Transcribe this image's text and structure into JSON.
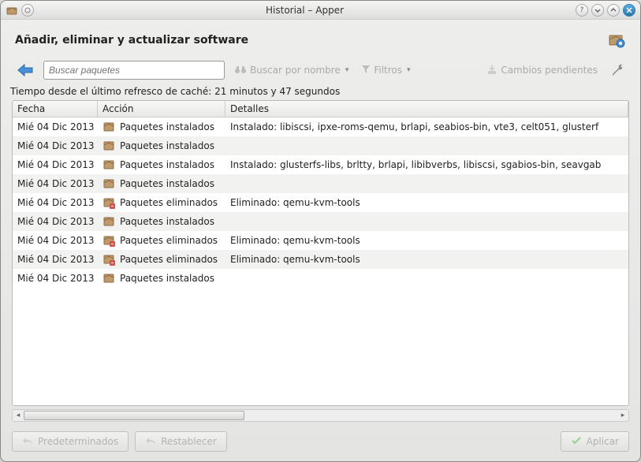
{
  "window": {
    "title": "Historial – Apper"
  },
  "header": {
    "title": "Añadir, eliminar y actualizar software"
  },
  "toolbar": {
    "search_placeholder": "Buscar paquetes",
    "search_by_name": "Buscar por nombre",
    "filters": "Filtros",
    "pending_changes": "Cambios pendientes"
  },
  "cache_status": "Tiempo desde el último refresco de caché: 21 minutos y 47 segundos",
  "columns": {
    "date": "Fecha",
    "action": "Acción",
    "details": "Detalles"
  },
  "rows": [
    {
      "date": "Mié 04 Dic 2013",
      "icon": "install",
      "action": "Paquetes instalados",
      "details": "Instalado: libiscsi, ipxe-roms-qemu, brlapi, seabios-bin, vte3, celt051, glusterf"
    },
    {
      "date": "Mié 04 Dic 2013",
      "icon": "install",
      "action": "Paquetes instalados",
      "details": ""
    },
    {
      "date": "Mié 04 Dic 2013",
      "icon": "install",
      "action": "Paquetes instalados",
      "details": "Instalado: glusterfs-libs, brltty, brlapi, libibverbs, libiscsi, sgabios-bin, seavgab"
    },
    {
      "date": "Mié 04 Dic 2013",
      "icon": "install",
      "action": "Paquetes instalados",
      "details": ""
    },
    {
      "date": "Mié 04 Dic 2013",
      "icon": "remove",
      "action": "Paquetes eliminados",
      "details": "Eliminado: qemu-kvm-tools"
    },
    {
      "date": "Mié 04 Dic 2013",
      "icon": "install",
      "action": "Paquetes instalados",
      "details": ""
    },
    {
      "date": "Mié 04 Dic 2013",
      "icon": "remove",
      "action": "Paquetes eliminados",
      "details": "Eliminado: qemu-kvm-tools"
    },
    {
      "date": "Mié 04 Dic 2013",
      "icon": "remove",
      "action": "Paquetes eliminados",
      "details": "Eliminado: qemu-kvm-tools"
    },
    {
      "date": "Mié 04 Dic 2013",
      "icon": "install",
      "action": "Paquetes instalados",
      "details": ""
    }
  ],
  "footer": {
    "defaults": "Predeterminados",
    "reset": "Restablecer",
    "apply": "Aplicar"
  }
}
